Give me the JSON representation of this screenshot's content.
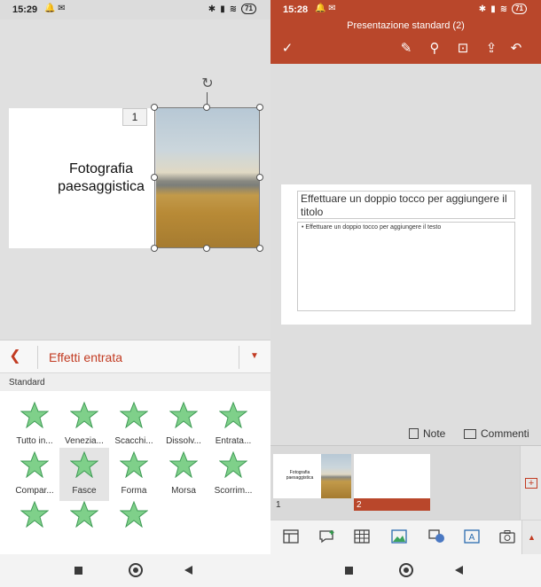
{
  "left": {
    "status": {
      "time": "15:29",
      "battery": "71"
    },
    "slide": {
      "number": "1",
      "title": "Fotografia paesaggistica"
    },
    "effects": {
      "title": "Effetti entrata",
      "category": "Standard",
      "items": [
        {
          "label": "Tutto in..."
        },
        {
          "label": "Venezia..."
        },
        {
          "label": "Scacchi..."
        },
        {
          "label": "Dissolv..."
        },
        {
          "label": "Entrata..."
        },
        {
          "label": "Compar..."
        },
        {
          "label": "Fasce"
        },
        {
          "label": "Forma"
        },
        {
          "label": "Morsa"
        },
        {
          "label": "Scorrim..."
        },
        {
          "label": ""
        },
        {
          "label": ""
        },
        {
          "label": ""
        }
      ]
    }
  },
  "right": {
    "status": {
      "time": "15:28",
      "battery": "71"
    },
    "doc_title": "Presentazione standard (2)",
    "slide": {
      "title_placeholder": "Effettuare un doppio tocco per aggiungere il titolo",
      "body_placeholder": "• Effettuare un doppio tocco per aggiungere il testo"
    },
    "tools": {
      "notes": "Note",
      "comments": "Commenti"
    },
    "thumbs": [
      {
        "num": "1",
        "title": "Fotografia paesaggistica"
      },
      {
        "num": "2"
      }
    ]
  },
  "colors": {
    "accent": "#b9472b",
    "star": "#7fd08a"
  }
}
